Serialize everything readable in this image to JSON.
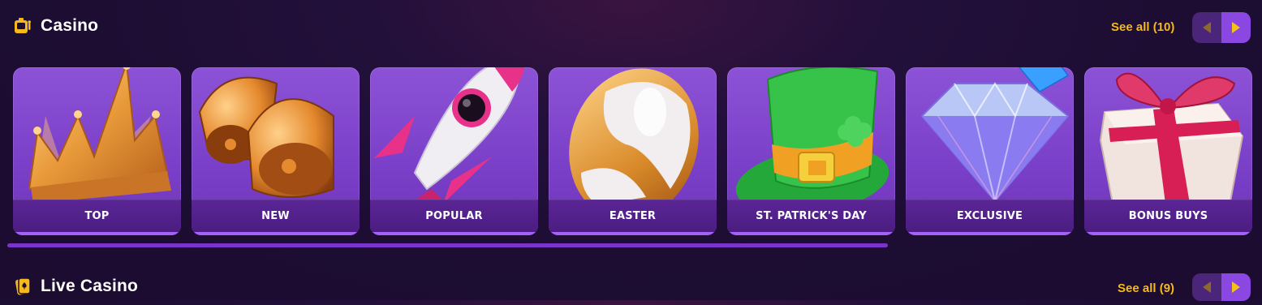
{
  "casino": {
    "title": "Casino",
    "see_all": "See all (10)",
    "icon": "slot-machine-icon",
    "categories": [
      {
        "label": "TOP",
        "icon": "crown-icon"
      },
      {
        "label": "NEW",
        "icon": "bells-icon"
      },
      {
        "label": "POPULAR",
        "icon": "rocket-icon"
      },
      {
        "label": "EASTER",
        "icon": "easter-egg-icon"
      },
      {
        "label": "ST. PATRICK'S DAY",
        "icon": "leprechaun-hat-icon"
      },
      {
        "label": "EXCLUSIVE",
        "icon": "diamond-icon"
      },
      {
        "label": "BONUS BUYS",
        "icon": "gift-box-icon"
      }
    ]
  },
  "live_casino": {
    "title": "Live Casino",
    "see_all": "See all (9)",
    "icon": "playing-card-icon"
  },
  "colors": {
    "accent": "#f5b91d",
    "card_bg": "#7a3fc8",
    "label_bar": "#4a1d80",
    "nav_next": "#8a47e2",
    "nav_prev": "#4b2579"
  }
}
